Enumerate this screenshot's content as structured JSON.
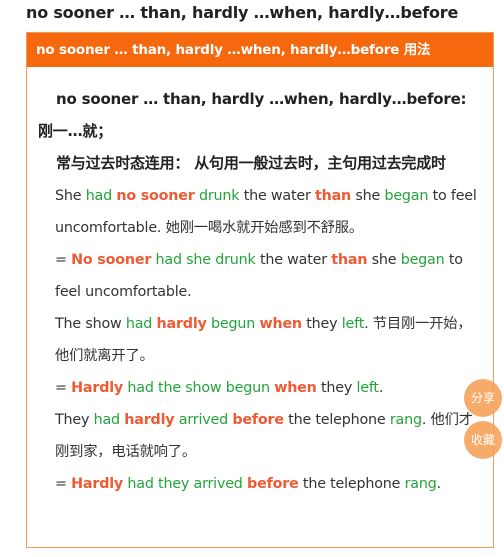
{
  "page": {
    "title": "no sooner … than, hardly …when, hardly…before"
  },
  "card": {
    "header": "no sooner … than, hardly …when, hardly…before 用法",
    "meaning": "no sooner … than, hardly …when, hardly…before: 刚一…就；",
    "tense_rule": "常与过去时态连用： 从句用一般过去时，主句用过去完成时",
    "examples": [
      {
        "text": "She had no sooner drunk the water than she began to feel uncomfortable. 她刚一喝水就开始感到不舒服。"
      },
      {
        "text": "= No sooner had she drunk the water than she began to feel uncomfortable."
      },
      {
        "text": "The show had hardly begun when they left. 节目刚一开始，他们就离开了。"
      },
      {
        "text": "= Hardly had the show begun when they left."
      },
      {
        "text": "They had hardly arrived before the telephone rang. 他们才刚到家，电话就响了。"
      },
      {
        "text": "= Hardly had they arrived before the telephone rang."
      }
    ]
  },
  "floating": {
    "share_label": "分享",
    "favorite_label": "收藏"
  },
  "colors": {
    "header_bg": "#f5680d",
    "keyword_red": "#ee5a33",
    "keyword_green": "#23a33b",
    "float_button": "#f7a25c"
  }
}
